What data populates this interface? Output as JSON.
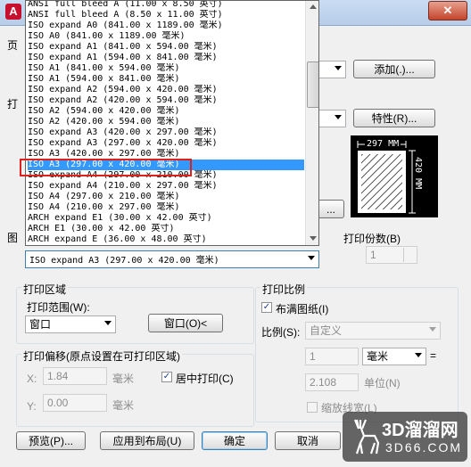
{
  "titlebar": {
    "close": "✕"
  },
  "app_icon": "A",
  "buttons": {
    "add": "添加(.)...",
    "properties": "特性(R)...",
    "window": "窗口(O)<",
    "preview": "预览(P)...",
    "apply_layout": "应用到布局(U)",
    "ok": "确定",
    "cancel": "取消",
    "ellipsis": "..."
  },
  "paper_size": {
    "selected": "ISO expand A3 (297.00 x 420.00 毫米)",
    "items": [
      "ANSI full bleed A (11.00 x 8.50 英寸)",
      "ANSI full bleed A (8.50 x 11.00 英寸)",
      "ISO expand A0 (841.00 x 1189.00 毫米)",
      "ISO A0 (841.00 x 1189.00 毫米)",
      "ISO expand A1 (841.00 x 594.00 毫米)",
      "ISO expand A1 (594.00 x 841.00 毫米)",
      "ISO A1 (841.00 x 594.00 毫米)",
      "ISO A1 (594.00 x 841.00 毫米)",
      "ISO expand A2 (594.00 x 420.00 毫米)",
      "ISO expand A2 (420.00 x 594.00 毫米)",
      "ISO A2 (594.00 x 420.00 毫米)",
      "ISO A2 (420.00 x 594.00 毫米)",
      "ISO expand A3 (420.00 x 297.00 毫米)",
      "ISO expand A3 (297.00 x 420.00 毫米)",
      "ISO A3 (420.00 x 297.00 毫米)",
      "ISO A3 (297.00 x 420.00 毫米)",
      "ISO expand A4 (297.00 x 210.00 毫米)",
      "ISO expand A4 (210.00 x 297.00 毫米)",
      "ISO A4 (297.00 x 210.00 毫米)",
      "ISO A4 (210.00 x 297.00 毫米)",
      "ARCH expand E1 (30.00 x 42.00 英寸)",
      "ARCH E1 (30.00 x 42.00 英寸)",
      "ARCH expand E (36.00 x 48.00 英寸)"
    ],
    "highlighted_index": 15
  },
  "preview": {
    "width_label": "297 MM",
    "height_label": "420 MM"
  },
  "copies": {
    "label": "打印份数(B)",
    "value": "1"
  },
  "plot_area": {
    "title": "打印区域",
    "range_label": "打印范围(W):",
    "range_value": "窗口"
  },
  "plot_scale": {
    "title": "打印比例",
    "fit_paper": "布满图纸(I)",
    "fit_checked": true,
    "scale_label": "比例(S):",
    "scale_value": "自定义",
    "value1": "1",
    "unit": "毫米",
    "equals": "=",
    "value2": "2.108",
    "unit2": "单位(N)",
    "lineweights": "缩放线宽(L)"
  },
  "plot_offset": {
    "title": "打印偏移(原点设置在可打印区域)",
    "x_label": "X:",
    "x_value": "1.84",
    "x_unit": "毫米",
    "center_label": "居中打印(C)",
    "center_checked": true,
    "y_label": "Y:",
    "y_value": "0.00",
    "y_unit": "毫米"
  },
  "fragments": {
    "a": "页",
    "b": "打",
    "c": "图"
  },
  "watermark": {
    "main": "3D溜溜网",
    "sub": "3D66.COM"
  }
}
